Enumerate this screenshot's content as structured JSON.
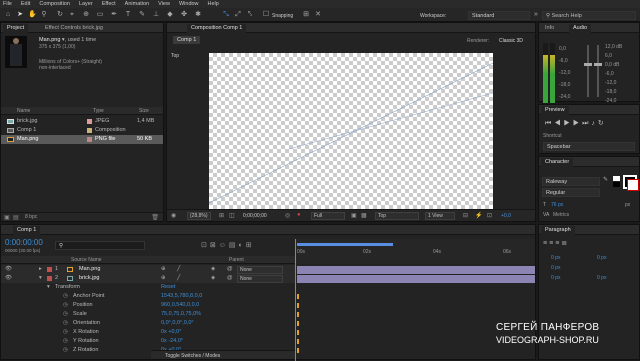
{
  "menu": [
    "File",
    "Edit",
    "Composition",
    "Layer",
    "Effect",
    "Animation",
    "View",
    "Window",
    "Help"
  ],
  "toolbar": {
    "snapping": "Snapping",
    "workspace_label": "Workspace:",
    "workspace_value": "Standard",
    "search_placeholder": "Search Help"
  },
  "project": {
    "tab_project": "Project",
    "tab_effect_controls": "Effect Controls brick.jpg",
    "selected_name": "Man.png",
    "selected_used": ", used 1 time",
    "selected_dims": "375 x 375 (1,00)",
    "selected_colors": "Millions of Colors+ (Straight)",
    "selected_interlace": "non-interlaced",
    "col_name": "Name",
    "col_type": "Type",
    "col_size": "Size",
    "items": [
      {
        "name": "brick.jpg",
        "type": "JPEG",
        "size": "1,4 MB"
      },
      {
        "name": "Comp 1",
        "type": "Composition",
        "size": ""
      },
      {
        "name": "Man.png",
        "type": "PNG file",
        "size": "50 KB"
      }
    ],
    "bpc": "8 bpc"
  },
  "composition": {
    "tab": "Composition Comp 1",
    "subtab": "Comp 1",
    "renderer_label": "Renderer:",
    "renderer_value": "Classic 3D",
    "view_label": "Top",
    "zoom": "(28,8%)",
    "timecode": "0;00;00;00",
    "quality": "Full",
    "view": "Top",
    "views": "1 View",
    "exposure": "+0,0"
  },
  "info_audio": {
    "tab_info": "Info",
    "tab_audio": "Audio",
    "db_left": [
      "0,0",
      "-6,0",
      "-12,0",
      "-18,0",
      "-24,0"
    ],
    "db_right": [
      "12,0 dB",
      "6,0",
      "0,0 dB",
      "-6,0",
      "-12,0",
      "-18,0",
      "-24,0"
    ]
  },
  "preview": {
    "tab": "Preview",
    "shortcut_label": "Shortcut",
    "shortcut_value": "Spacebar"
  },
  "character": {
    "tab": "Character",
    "font": "Raleway",
    "style": "Regular",
    "size": "76 px",
    "tracking": "Metrics",
    "px_label": "px"
  },
  "paragraph": {
    "tab": "Paragraph",
    "fields": [
      "0 px",
      "0 px",
      "0 px",
      "0 px",
      "0 px"
    ]
  },
  "timeline": {
    "tab": "Comp 1",
    "timecode": "0:00:00:00",
    "fps": "00000 (30.00 fps)",
    "col_source": "Source Name",
    "col_parent": "Parent",
    "ruler": [
      "00s",
      "02s",
      "04s",
      "06s"
    ],
    "layers": [
      {
        "num": "1",
        "name": "Man.png",
        "parent": "None"
      },
      {
        "num": "2",
        "name": "brick.jpg",
        "parent": "None"
      }
    ],
    "transform_label": "Transform",
    "reset_label": "Reset",
    "props": [
      {
        "name": "Anchor Point",
        "value": "1543,5,780,8,0,0"
      },
      {
        "name": "Position",
        "value": "960,0,540,0,0,0"
      },
      {
        "name": "Scale",
        "value": "75,0,75,0,75,0%"
      },
      {
        "name": "Orientation",
        "value": "0,0°,0,0°,0,0°"
      },
      {
        "name": "X Rotation",
        "value": "0x +0,0°"
      },
      {
        "name": "Y Rotation",
        "value": "0x -24,0°"
      },
      {
        "name": "Z Rotation",
        "value": "0x +0,0°"
      }
    ],
    "toggle_label": "Toggle Switches / Modes"
  },
  "watermark": {
    "name": "СЕРГЕЙ ПАНФЕРОВ",
    "site": "VIDEOGRAPH-SHOP.RU"
  },
  "colors": {
    "accent": "#3d8fd6",
    "layer_bar": "#8c84b3",
    "label_red": "#c0504d",
    "playhead": "#5a8ee0",
    "meter_green": "#3aa53a",
    "meter_yellow": "#c9b52a"
  }
}
